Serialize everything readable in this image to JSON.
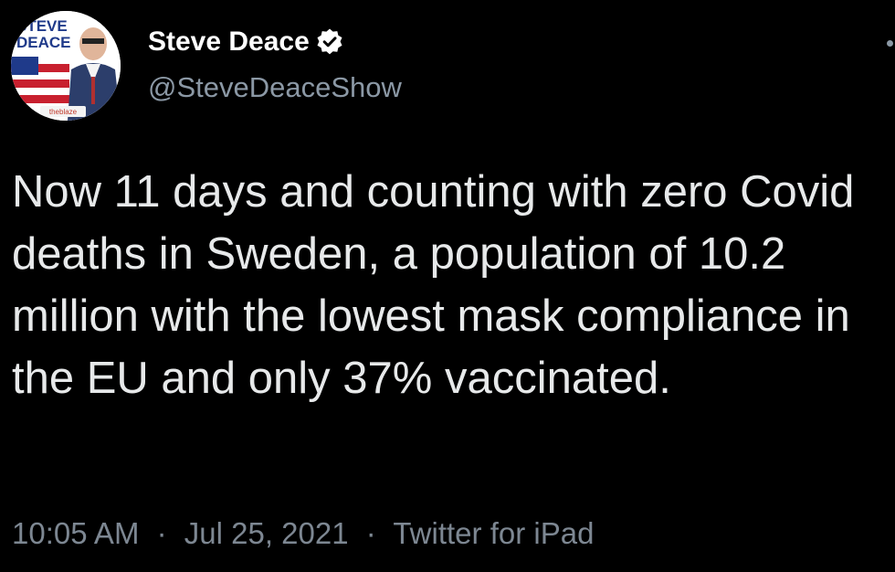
{
  "author": {
    "display_name": "Steve Deace",
    "handle": "@SteveDeaceShow",
    "verified": true,
    "avatar_text_line1": "STEVE",
    "avatar_text_line2": "DEACE",
    "avatar_badge": "theblaze"
  },
  "tweet": {
    "text": "Now 11 days and counting with zero Covid deaths in Sweden, a population of 10.2 million with the lowest mask compliance in the EU and only 37% vaccinated."
  },
  "meta": {
    "time": "10:05 AM",
    "date": "Jul 25, 2021",
    "source": "Twitter for iPad",
    "separator": "·"
  },
  "colors": {
    "background": "#000000",
    "text": "#e7e9ea",
    "secondary": "#8b98a5",
    "verified_badge": "#ffffff"
  },
  "icons": [
    "verified-icon",
    "more-options-icon"
  ]
}
